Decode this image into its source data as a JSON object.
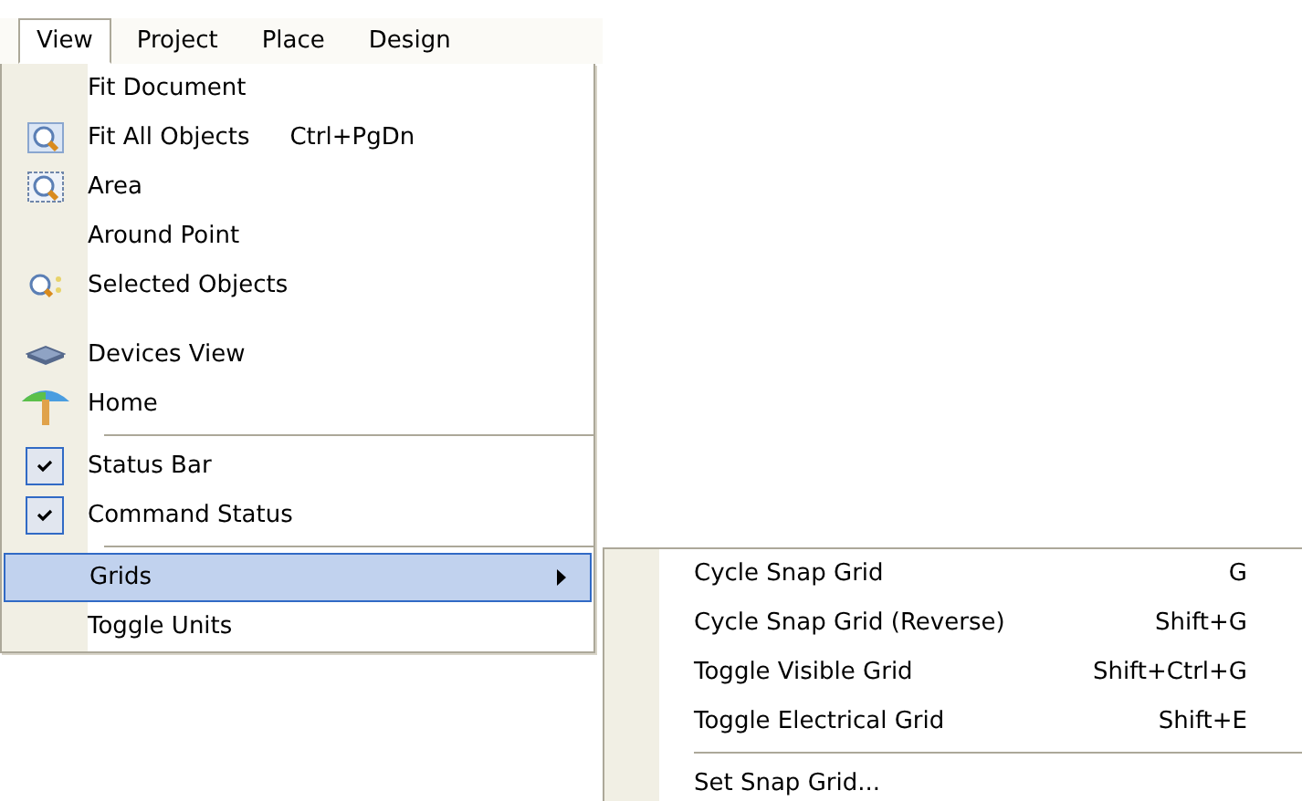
{
  "menubar": [
    {
      "label": "View",
      "selected": true
    },
    {
      "label": "Project",
      "selected": false
    },
    {
      "label": "Place",
      "selected": false
    },
    {
      "label": "Design",
      "selected": false
    }
  ],
  "menu": {
    "items": [
      {
        "kind": "plain",
        "label": "Fit Document",
        "checked": false,
        "selected": false,
        "submenu": false
      },
      {
        "kind": "zoom",
        "label": "Fit All Objects",
        "shortcut": "Ctrl+PgDn",
        "checked": false,
        "selected": false,
        "submenu": false
      },
      {
        "kind": "zoomarea",
        "label": "Area",
        "checked": false,
        "selected": false,
        "submenu": false
      },
      {
        "kind": "plain",
        "label": "Around Point",
        "checked": false,
        "selected": false,
        "submenu": false
      },
      {
        "kind": "zoomselection",
        "label": "Selected Objects",
        "checked": false,
        "selected": false,
        "submenu": false
      },
      {
        "kind": "cut"
      },
      {
        "kind": "devices",
        "label": "Devices View",
        "checked": false,
        "selected": false,
        "submenu": false
      },
      {
        "kind": "home",
        "label": "Home",
        "checked": false,
        "selected": false,
        "submenu": false
      },
      {
        "kind": "separator"
      },
      {
        "kind": "plain",
        "label": "Status Bar",
        "checked": true,
        "selected": false,
        "submenu": false
      },
      {
        "kind": "plain",
        "label": "Command Status",
        "checked": true,
        "selected": false,
        "submenu": false
      },
      {
        "kind": "separator"
      },
      {
        "kind": "plain",
        "label": "Grids",
        "checked": false,
        "selected": true,
        "submenu": true
      },
      {
        "kind": "plain",
        "label": "Toggle Units",
        "checked": false,
        "selected": false,
        "submenu": false
      }
    ]
  },
  "submenu": {
    "items": [
      {
        "kind": "item",
        "label": "Cycle Snap Grid",
        "shortcut": "G"
      },
      {
        "kind": "item",
        "label": "Cycle Snap Grid (Reverse)",
        "shortcut": "Shift+G"
      },
      {
        "kind": "item",
        "label": "Toggle Visible Grid",
        "shortcut": "Shift+Ctrl+G"
      },
      {
        "kind": "item",
        "label": "Toggle Electrical Grid",
        "shortcut": "Shift+E"
      },
      {
        "kind": "separator"
      },
      {
        "kind": "item",
        "label": "Set Snap Grid..."
      }
    ]
  }
}
